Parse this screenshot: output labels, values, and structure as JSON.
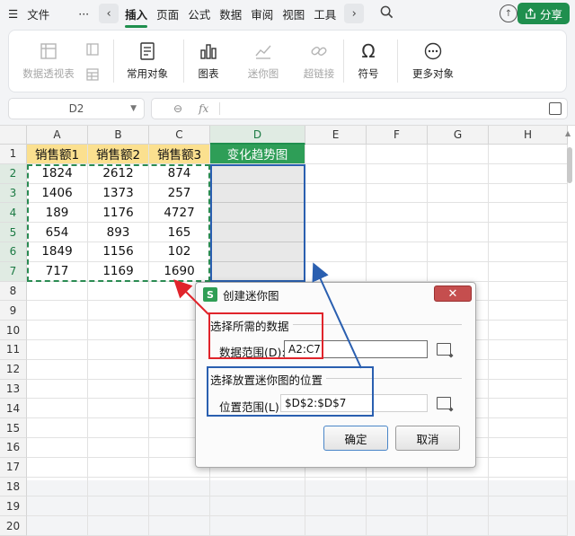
{
  "menubar": {
    "hamburger_icon": "menu-icon",
    "file_label": "文件",
    "more_label": "···",
    "tabs": [
      "插入",
      "页面",
      "公式",
      "数据",
      "审阅",
      "视图",
      "工具"
    ],
    "active_tab": "插入",
    "share_label": "分享",
    "accent_color": "#1f8f4e"
  },
  "ribbon": {
    "buttons": [
      {
        "label": "数据透视表",
        "icon": "pivot-table-icon",
        "enabled": false
      },
      {
        "label": "常用对象",
        "icon": "common-objects-icon",
        "enabled": true
      },
      {
        "label": "图表",
        "icon": "chart-icon",
        "enabled": true
      },
      {
        "label": "迷你图",
        "icon": "sparkline-icon",
        "enabled": false
      },
      {
        "label": "超链接",
        "icon": "hyperlink-icon",
        "enabled": false
      },
      {
        "label": "符号",
        "icon": "omega-symbol-icon",
        "enabled": true
      },
      {
        "label": "更多对象",
        "icon": "more-objects-icon",
        "enabled": true
      }
    ]
  },
  "formula_bar": {
    "name_box": "D2",
    "fx_label": "fx",
    "value": ""
  },
  "sheet": {
    "columns": [
      "A",
      "B",
      "C",
      "D",
      "E",
      "F",
      "G",
      "H"
    ],
    "rows": [
      "1",
      "2",
      "3",
      "4",
      "5",
      "6",
      "7",
      "8",
      "9",
      "10",
      "11",
      "12",
      "13",
      "14",
      "15",
      "16",
      "17",
      "18",
      "19",
      "20"
    ],
    "headers": [
      "销售额1",
      "销售额2",
      "销售额3",
      "变化趋势图"
    ],
    "data": [
      [
        "1824",
        "2612",
        "874"
      ],
      [
        "1406",
        "1373",
        "257"
      ],
      [
        "189",
        "1176",
        "4727"
      ],
      [
        "654",
        "893",
        "165"
      ],
      [
        "1849",
        "1156",
        "102"
      ],
      [
        "717",
        "1169",
        "1690"
      ]
    ],
    "header_fill": "#fbe08f",
    "d1_fill": "#2e9e57"
  },
  "dialog": {
    "title": "创建迷你图",
    "logo": "S",
    "group1_title": "选择所需的数据",
    "data_range_label": "数据范围(D):",
    "data_range_value": "A2:C7",
    "group2_title": "选择放置迷你图的位置",
    "location_label": "位置范围(L):",
    "location_value": "$D$2:$D$7",
    "ok_label": "确定",
    "cancel_label": "取消"
  }
}
